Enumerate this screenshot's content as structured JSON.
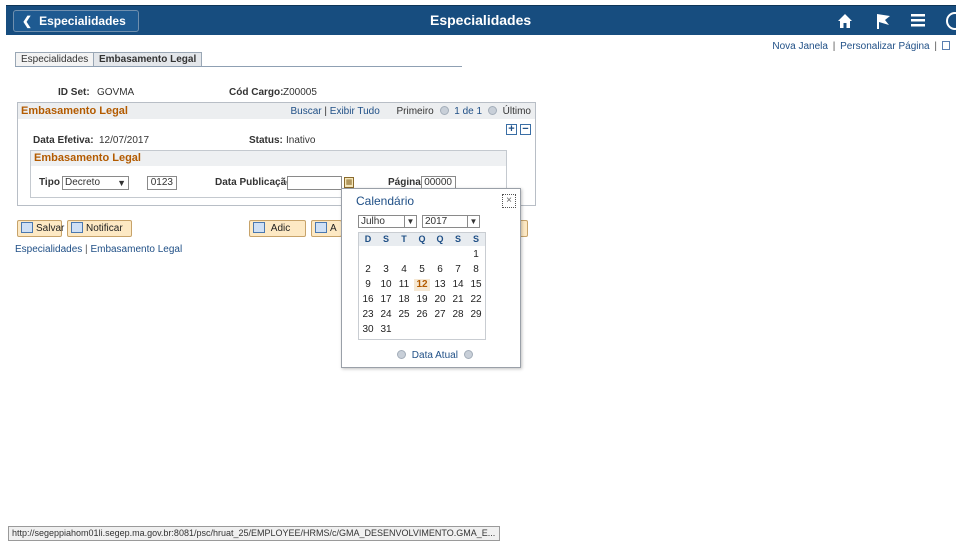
{
  "header": {
    "back_label": "Especialidades",
    "title": "Especialidades",
    "icons": [
      "home-icon",
      "flag-icon",
      "menu-icon",
      "compass-icon"
    ],
    "brand_color": "#174d7f"
  },
  "toplinks": {
    "new_window": "Nova Janela",
    "sep": "|",
    "personalize": "Personalizar Página",
    "sep2": "|"
  },
  "tabs": [
    {
      "label": "Especialidades",
      "active": false
    },
    {
      "label": "Embasamento Legal",
      "active": true
    }
  ],
  "ids": {
    "id_set_label": "ID Set:",
    "id_set_value": "GOVMA",
    "cargo_label": "Cód Cargo:",
    "cargo_value": "Z00005"
  },
  "grid": {
    "title": "Embasamento Legal",
    "find": "Buscar",
    "sep": "|",
    "show_all": "Exibir Tudo",
    "first": "Primeiro",
    "range": "1 de 1",
    "last": "Último",
    "add": "+",
    "remove": "−",
    "eff_date_label": "Data Efetiva:",
    "eff_date_value": "12/07/2017",
    "status_label": "Status:",
    "status_value": "Inativo"
  },
  "inner": {
    "title": "Embasamento Legal",
    "tipo_label": "Tipo",
    "tipo_value": "Decreto",
    "number_value": "0123",
    "pub_label": "Data Publicação",
    "pub_value": "",
    "page_label": "Página",
    "page_value": "00000"
  },
  "buttons": {
    "save": "Salvar",
    "notify": "Notificar",
    "add": "Adic",
    "update": "A"
  },
  "bottom_links": {
    "first": "Especialidades",
    "sep": "|",
    "second": "Embasamento Legal"
  },
  "calendar": {
    "title": "Calendário",
    "close": "×",
    "month": "Julho",
    "year": "2017",
    "dow": [
      "D",
      "S",
      "T",
      "Q",
      "Q",
      "S",
      "S"
    ],
    "weeks": [
      [
        "",
        "",
        "",
        "",
        "",
        "",
        "1"
      ],
      [
        "2",
        "3",
        "4",
        "5",
        "6",
        "7",
        "8"
      ],
      [
        "9",
        "10",
        "11",
        "12",
        "13",
        "14",
        "15"
      ],
      [
        "16",
        "17",
        "18",
        "19",
        "20",
        "21",
        "22"
      ],
      [
        "23",
        "24",
        "25",
        "26",
        "27",
        "28",
        "29"
      ],
      [
        "30",
        "31",
        "",
        "",
        "",
        "",
        ""
      ]
    ],
    "today": "12",
    "footer": "Data Atual"
  },
  "statusbar": "http://segeppiahom01li.segep.ma.gov.br:8081/psc/hruat_25/EMPLOYEE/HRMS/c/GMA_DESENVOLVIMENTO.GMA_E..."
}
